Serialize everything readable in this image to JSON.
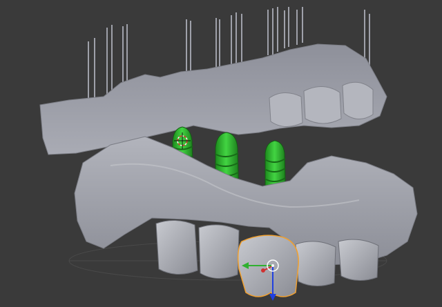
{
  "viewport": {
    "mode": "3d-view",
    "background_color": "#3a3a3a"
  },
  "scene": {
    "models": [
      {
        "name": "upper-jaw-scan",
        "color": "#9a9ca6"
      },
      {
        "name": "lower-jaw-scan",
        "color": "#a2a4ad"
      }
    ],
    "implants": [
      {
        "name": "implant-1",
        "color": "#2fb52f"
      },
      {
        "name": "implant-2",
        "color": "#2fb52f"
      },
      {
        "name": "implant-3",
        "color": "#2fb52f"
      }
    ],
    "selected_object": {
      "name": "selected-tooth",
      "outline_color": "#f0a030"
    },
    "transform_gizmo": {
      "x_axis_color": "#d03030",
      "y_axis_color": "#30b030",
      "z_axis_color": "#2040e0"
    },
    "cursor_3d": {
      "icon": "3d-cursor-icon"
    }
  }
}
